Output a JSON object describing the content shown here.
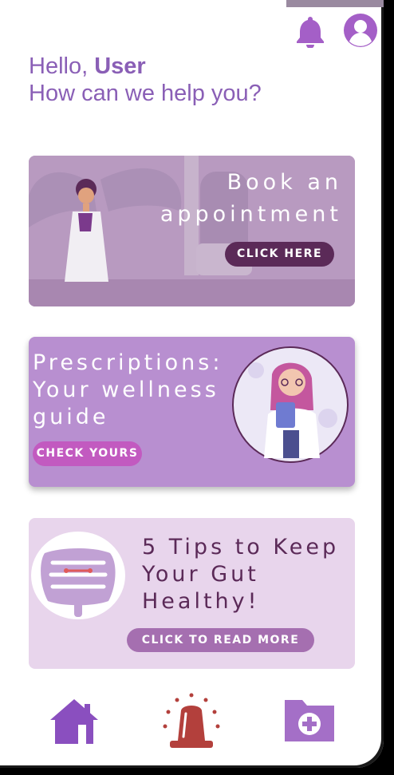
{
  "greeting": {
    "hello": "Hello, ",
    "user": "User",
    "subtitle": "How can we help you?"
  },
  "header": {
    "icons": [
      "bell-icon",
      "user-avatar-icon"
    ]
  },
  "cards": {
    "appointment": {
      "title_line1": "Book an",
      "title_line2": "appointment",
      "button": "CLICK HERE"
    },
    "prescriptions": {
      "title_line1": "Prescriptions:",
      "title_line2": "Your wellness",
      "title_line3": "guide",
      "button": "CHECK YOURS"
    },
    "gut": {
      "title_line1": "5 Tips to Keep",
      "title_line2": "Your Gut",
      "title_line3": "Healthy!",
      "button": "CLICK TO READ MORE"
    }
  },
  "nav": {
    "items": [
      "home-icon",
      "emergency-siren-icon",
      "medical-folder-icon"
    ]
  },
  "colors": {
    "accent": "#8a5fb6",
    "dark_plum": "#5b2a58",
    "siren_red": "#b3403c"
  }
}
